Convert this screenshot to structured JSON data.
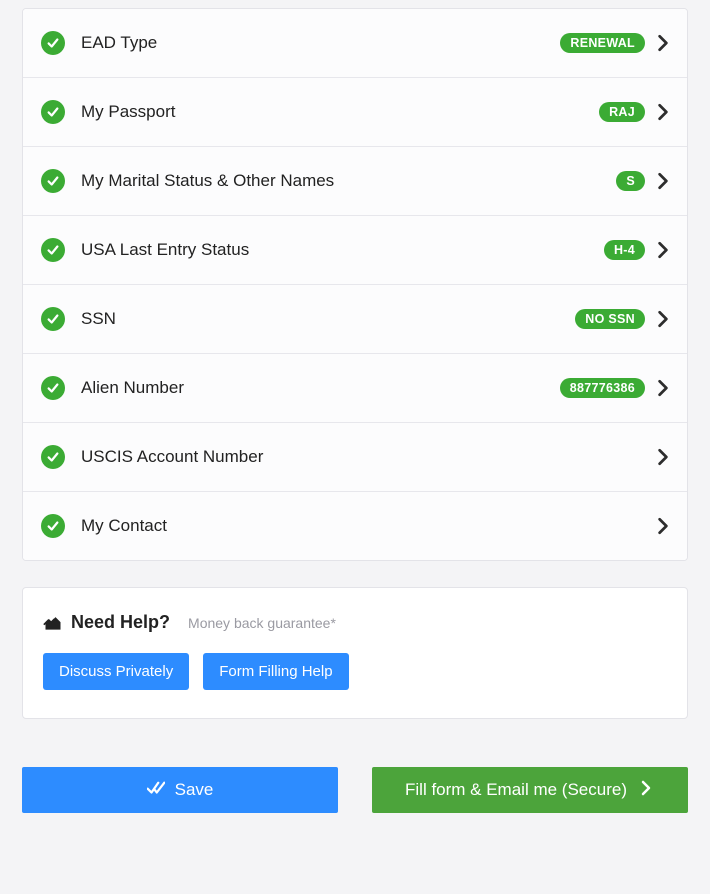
{
  "accordion": {
    "items": [
      {
        "label": "EAD Type",
        "badge": "RENEWAL"
      },
      {
        "label": "My Passport",
        "badge": "RAJ"
      },
      {
        "label": "My Marital Status & Other Names",
        "badge": "S"
      },
      {
        "label": "USA Last Entry Status",
        "badge": "H-4"
      },
      {
        "label": "SSN",
        "badge": "NO SSN"
      },
      {
        "label": "Alien Number",
        "badge": "887776386"
      },
      {
        "label": "USCIS Account Number",
        "badge": ""
      },
      {
        "label": "My Contact",
        "badge": ""
      }
    ]
  },
  "help": {
    "title": "Need Help?",
    "subtitle": "Money back guarantee*",
    "discuss": "Discuss Privately",
    "formhelp": "Form Filling Help"
  },
  "footer": {
    "save": "Save",
    "fill": "Fill form & Email me (Secure)"
  }
}
